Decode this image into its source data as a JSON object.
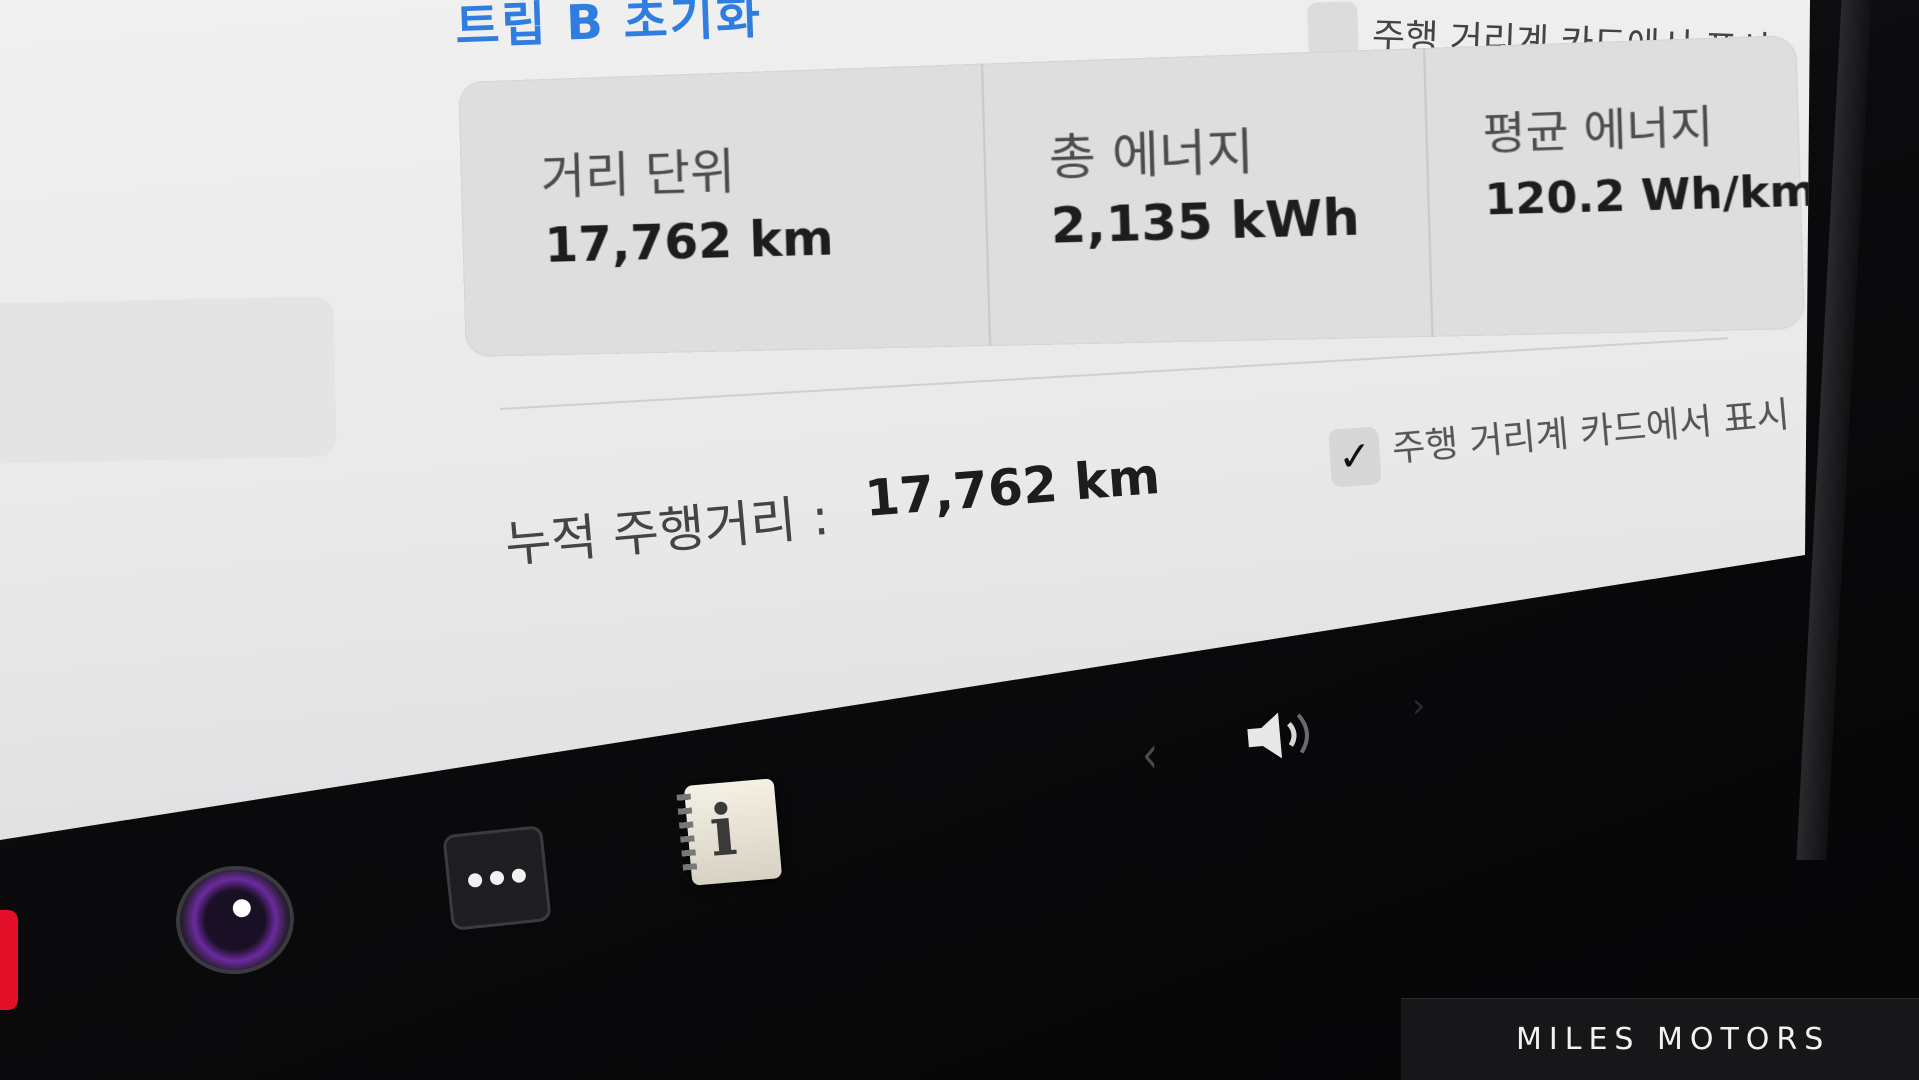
{
  "trip": {
    "reset_label": "트립 B   초기화",
    "show_on_card_label": "주행 거리계 카드에서 표시",
    "show_on_card_checked": false
  },
  "stats": [
    {
      "label": "거리 단위",
      "value": "17,762 km"
    },
    {
      "label": "총 에너지",
      "value": "2,135 kWh"
    },
    {
      "label": "평균 에너지",
      "value": "120.2 Wh/km"
    }
  ],
  "odometer": {
    "label": "누적 주행거리 :",
    "value": "17,762 km",
    "show_on_card_label": "주행 거리계 카드에서 표시",
    "show_on_card_checked": true,
    "check_glyph": "✓"
  },
  "taskbar": {
    "icons": [
      "camera-icon",
      "more-dots-icon",
      "owners-manual-icon",
      "chevron-left-icon",
      "volume-icon",
      "chevron-right-icon"
    ],
    "manual_letter": "i",
    "chevron_left": "‹",
    "chevron_right": "›"
  },
  "watermark": {
    "text": "MILES MOTORS"
  },
  "colors": {
    "accent_blue": "#2f7de0",
    "screen_bg": "#ececed",
    "card_bg": "#dedede",
    "camera_ring": "#6b2a9e",
    "red_tab": "#e4102a"
  }
}
